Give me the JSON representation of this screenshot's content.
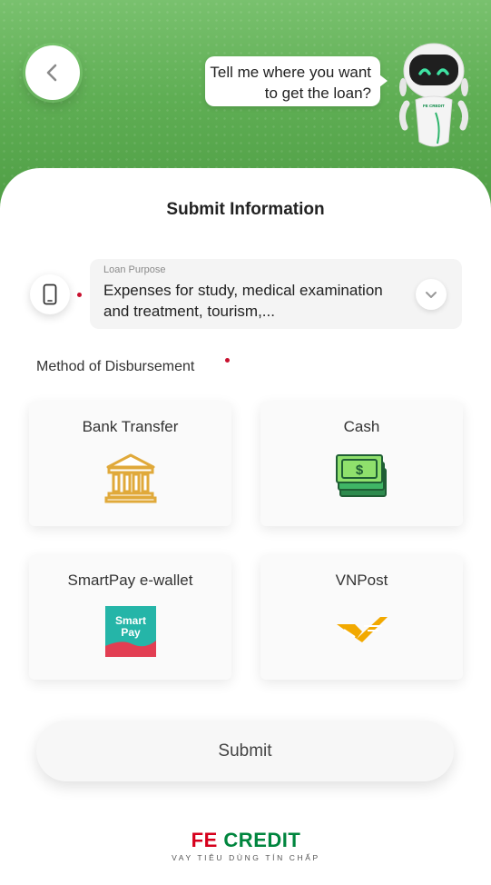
{
  "header": {
    "back_icon": "chevron-left-icon",
    "chat_message": "Tell me where you want to get the loan?",
    "robot_badge": "FE CREDIT",
    "colors": {
      "green_top": "#79c16e",
      "green_bottom": "#4e9d44"
    }
  },
  "form": {
    "title": "Submit Information",
    "loan_purpose": {
      "icon": "phone-icon",
      "label": "Loan Purpose",
      "value": "Expenses for study, medical examination and treatment, tourism,...",
      "dropdown_icon": "chevron-down-icon",
      "required": true
    },
    "disbursement": {
      "label": "Method of Disbursement",
      "required": true,
      "options": [
        {
          "label": "Bank Transfer",
          "icon": "bank-icon"
        },
        {
          "label": "Cash",
          "icon": "cash-icon",
          "icon_text": "$"
        },
        {
          "label": "SmartPay e-wallet",
          "icon": "smartpay-logo-icon",
          "icon_text_1": "Smart",
          "icon_text_2": "Pay"
        },
        {
          "label": "VNPost",
          "icon": "vnpost-logo-icon"
        }
      ]
    },
    "submit_label": "Submit"
  },
  "footer": {
    "logo_fe": "FE",
    "logo_credit": "CREDIT",
    "tagline": "VAY TIÊU DÙNG TÍN CHẤP"
  },
  "colors": {
    "required_dot": "#c8102e",
    "brand_red": "#d6001c",
    "brand_green": "#00853e",
    "accent_gold": "#e0a93a"
  }
}
